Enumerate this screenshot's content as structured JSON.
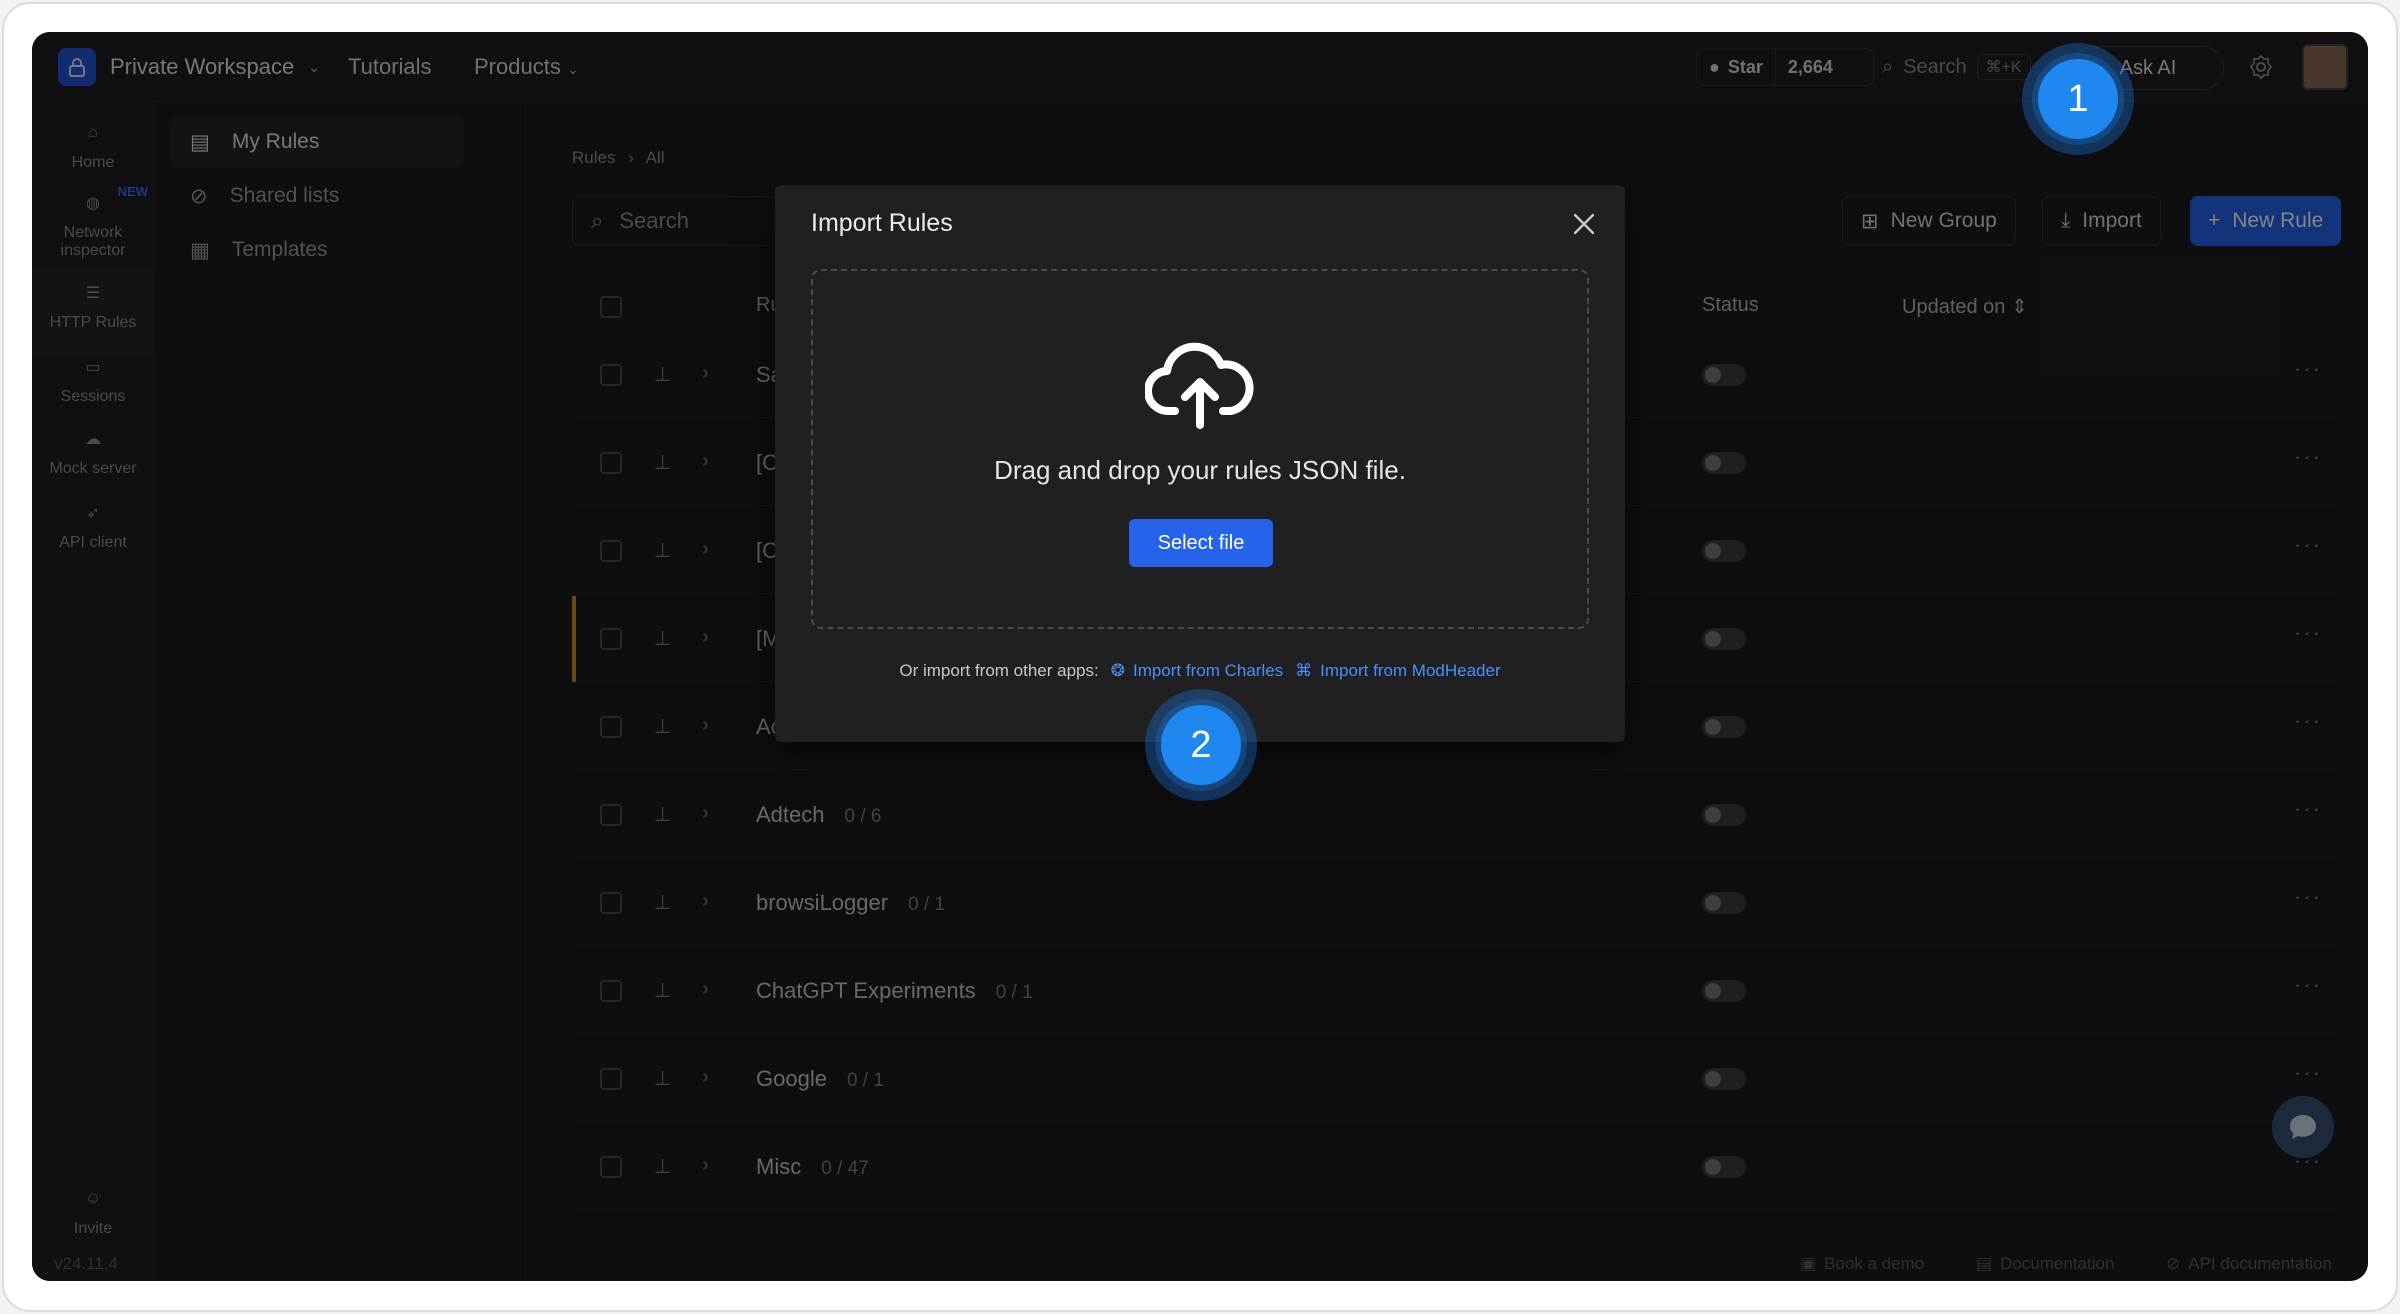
{
  "topbar": {
    "workspace": "Private Workspace",
    "nav": [
      "Tutorials",
      "Products"
    ],
    "star_label": "Star",
    "star_count": "2,664",
    "search_placeholder": "Search",
    "search_shortcut": "⌘+K",
    "ask_ai": "Ask AI"
  },
  "rail": {
    "items": [
      {
        "label": "Home"
      },
      {
        "label": "Network inspector",
        "badge": "NEW"
      },
      {
        "label": "HTTP Rules"
      },
      {
        "label": "Sessions"
      },
      {
        "label": "Mock server"
      },
      {
        "label": "API client"
      },
      {
        "label": "Invite"
      }
    ]
  },
  "sidebar": {
    "items": [
      "My Rules",
      "Shared lists",
      "Templates"
    ]
  },
  "main": {
    "breadcrumb": [
      "Rules",
      "All"
    ],
    "search_placeholder": "Search",
    "new_group": "New Group",
    "import": "Import",
    "new_rule": "New Rule",
    "columns": {
      "rules": "Rules",
      "status": "Status",
      "updated": "Updated on"
    },
    "rows": [
      {
        "name": "Sam",
        "count": ""
      },
      {
        "name": "[Cha",
        "count": ""
      },
      {
        "name": "[Cha",
        "count": ""
      },
      {
        "name": "[Mo",
        "count": ""
      },
      {
        "name": "Acad",
        "count": ""
      },
      {
        "name": "Adtech",
        "count": "0 / 6"
      },
      {
        "name": "browsiLogger",
        "count": "0 / 1"
      },
      {
        "name": "ChatGPT Experiments",
        "count": "0 / 1"
      },
      {
        "name": "Google",
        "count": "0 / 1"
      },
      {
        "name": "Misc",
        "count": "0 / 47"
      }
    ]
  },
  "footer": {
    "version": "v24.11.4",
    "book_demo": "Book a demo",
    "documentation": "Documentation",
    "api_docs": "API documentation"
  },
  "modal": {
    "title": "Import Rules",
    "drop_text": "Drag and drop your rules JSON file.",
    "select_file": "Select file",
    "other_prefix": "Or import from other apps:",
    "import_charles": "Import from Charles",
    "import_modheader": "Import from ModHeader"
  },
  "steps": [
    "1",
    "2"
  ],
  "colors": {
    "accent": "#2563eb",
    "step": "#1e88f0",
    "link": "#4c8ef7"
  }
}
